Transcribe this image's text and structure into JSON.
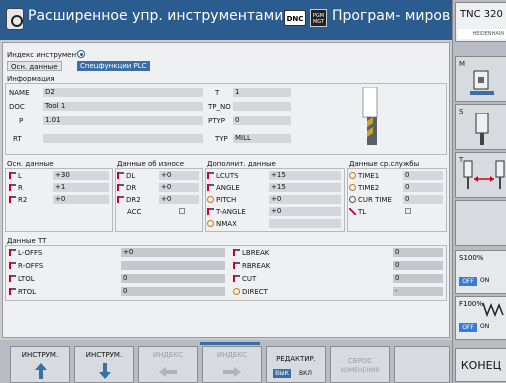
{
  "header": {
    "title": "Расширенное упр. инструментами",
    "dnc": "DNC",
    "pgm_badge": "PGM MGT",
    "program": "Програм- мирован..."
  },
  "right_panel": {
    "tnc_title": "TNC 320",
    "tnc_sub": "HEIDENHAIN",
    "buttons": [
      {
        "label": "M"
      },
      {
        "label": "S"
      },
      {
        "label": "T"
      }
    ],
    "overrides": [
      {
        "pct": "S100%",
        "off": "OFF",
        "on": "ON"
      },
      {
        "pct": "F100%",
        "off": "OFF",
        "on": "ON"
      }
    ],
    "end": "КОНЕЦ"
  },
  "main": {
    "index_label": "Индекс инструмента",
    "tabs": [
      "Осн. данные",
      "Спецфункции PLC"
    ],
    "info": {
      "title": "Информация",
      "rows": [
        {
          "label": "NAME",
          "value": "D2",
          "label2": "T",
          "value2": "1"
        },
        {
          "label": "DOC",
          "value": "Tool 1",
          "label2": "TP_NO",
          "value2": ""
        },
        {
          "label": "P",
          "value": "1.01",
          "label2": "PTYP",
          "value2": "0"
        },
        {
          "label": "RT",
          "value": "",
          "label2": "TYP",
          "value2": "MILL"
        }
      ]
    },
    "basic": {
      "title": "Осн. данные",
      "rows": [
        {
          "label": "L",
          "value": "+30"
        },
        {
          "label": "R",
          "value": "+1"
        },
        {
          "label": "R2",
          "value": "+0"
        }
      ]
    },
    "wear": {
      "title": "Данные об износе",
      "rows": [
        {
          "label": "DL",
          "value": "+0"
        },
        {
          "label": "DR",
          "value": "+0"
        },
        {
          "label": "DR2",
          "value": "+0"
        },
        {
          "label": "ACC",
          "value": ""
        }
      ]
    },
    "extra": {
      "title": "Дополнит. данные",
      "rows": [
        {
          "label": "LCUTS",
          "value": "+15"
        },
        {
          "label": "ANGLE",
          "value": "+15"
        },
        {
          "label": "PITCH",
          "value": "+0"
        },
        {
          "label": "T-ANGLE",
          "value": "+0"
        },
        {
          "label": "NMAX",
          "value": ""
        }
      ]
    },
    "life": {
      "title": "Данные ср.службы",
      "rows": [
        {
          "label": "TIME1",
          "value": "0"
        },
        {
          "label": "TIME2",
          "value": "0"
        },
        {
          "label": "CUR TIME",
          "value": "0"
        },
        {
          "label": "TL",
          "value": ""
        }
      ]
    },
    "tt": {
      "title": "Данные TT",
      "left": [
        {
          "label": "L-OFFS",
          "value": "+0"
        },
        {
          "label": "R-OFFS",
          "value": ""
        },
        {
          "label": "LTOL",
          "value": "0"
        },
        {
          "label": "RTOL",
          "value": "0"
        }
      ],
      "right": [
        {
          "label": "LBREAK",
          "value": "0"
        },
        {
          "label": "RBREAK",
          "value": "0"
        },
        {
          "label": "CUT",
          "value": "0"
        },
        {
          "label": "DIRECT",
          "value": "-"
        }
      ]
    }
  },
  "softkeys": [
    {
      "label": "ИНСТРУМ.",
      "arrow": "↑"
    },
    {
      "label": "ИНСТРУМ.",
      "arrow": "↓"
    },
    {
      "label": "ИНДЕКС",
      "arrow": "←"
    },
    {
      "label": "ИНДЕКС",
      "arrow": "→"
    },
    {
      "label": "РЕДАКТИР.",
      "sub_on": "ВЫК",
      "sub_off": "ВКЛ"
    },
    {
      "label": "СБРОС",
      "label2": "ИЗМЕНЕНИЯ"
    }
  ]
}
